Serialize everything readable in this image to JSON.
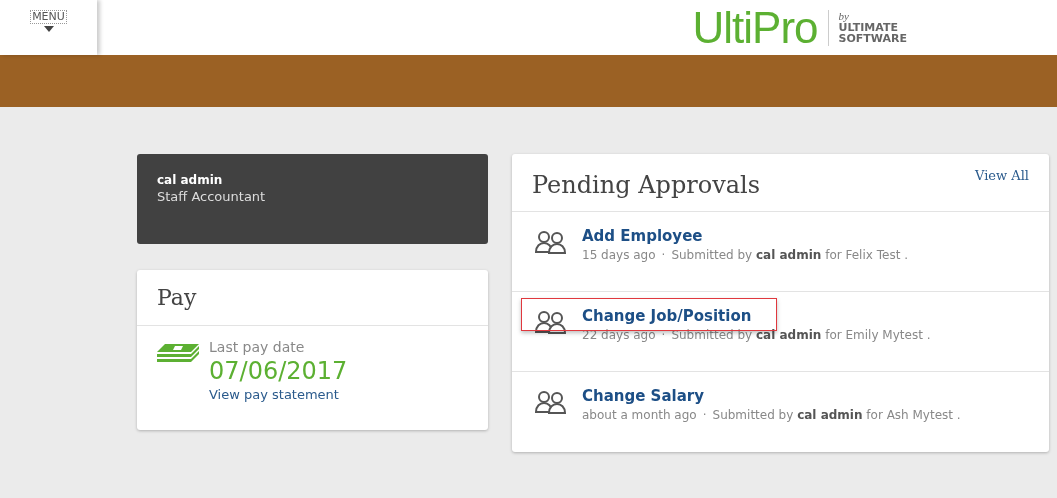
{
  "header": {
    "menu_label": "MENU",
    "logo": {
      "name": "UltiPro",
      "by": "by",
      "company_line_1": "ULTIMATE",
      "company_line_2": "SOFTWARE"
    }
  },
  "profile": {
    "name": "cal admin",
    "title": "Staff Accountant"
  },
  "pay": {
    "title": "Pay",
    "label": "Last pay date",
    "date": "07/06/2017",
    "link": "View pay statement"
  },
  "approvals": {
    "title": "Pending Approvals",
    "view_all": "View All",
    "items": [
      {
        "title": "Add Employee",
        "time": "15 days ago",
        "separator": "·",
        "detail": "Submitted by **cal admin** for Felix Test .",
        "highlighted": false
      },
      {
        "title": "Change Job/Position",
        "time": "22 days ago",
        "separator": "·",
        "detail": "Submitted by **cal admin** for Emily Mytest .",
        "highlighted": true
      },
      {
        "title": "Change Salary",
        "time": "about a month ago",
        "separator": "·",
        "detail": "Submitted by **cal admin** for Ash Mytest .",
        "highlighted": false
      }
    ]
  }
}
